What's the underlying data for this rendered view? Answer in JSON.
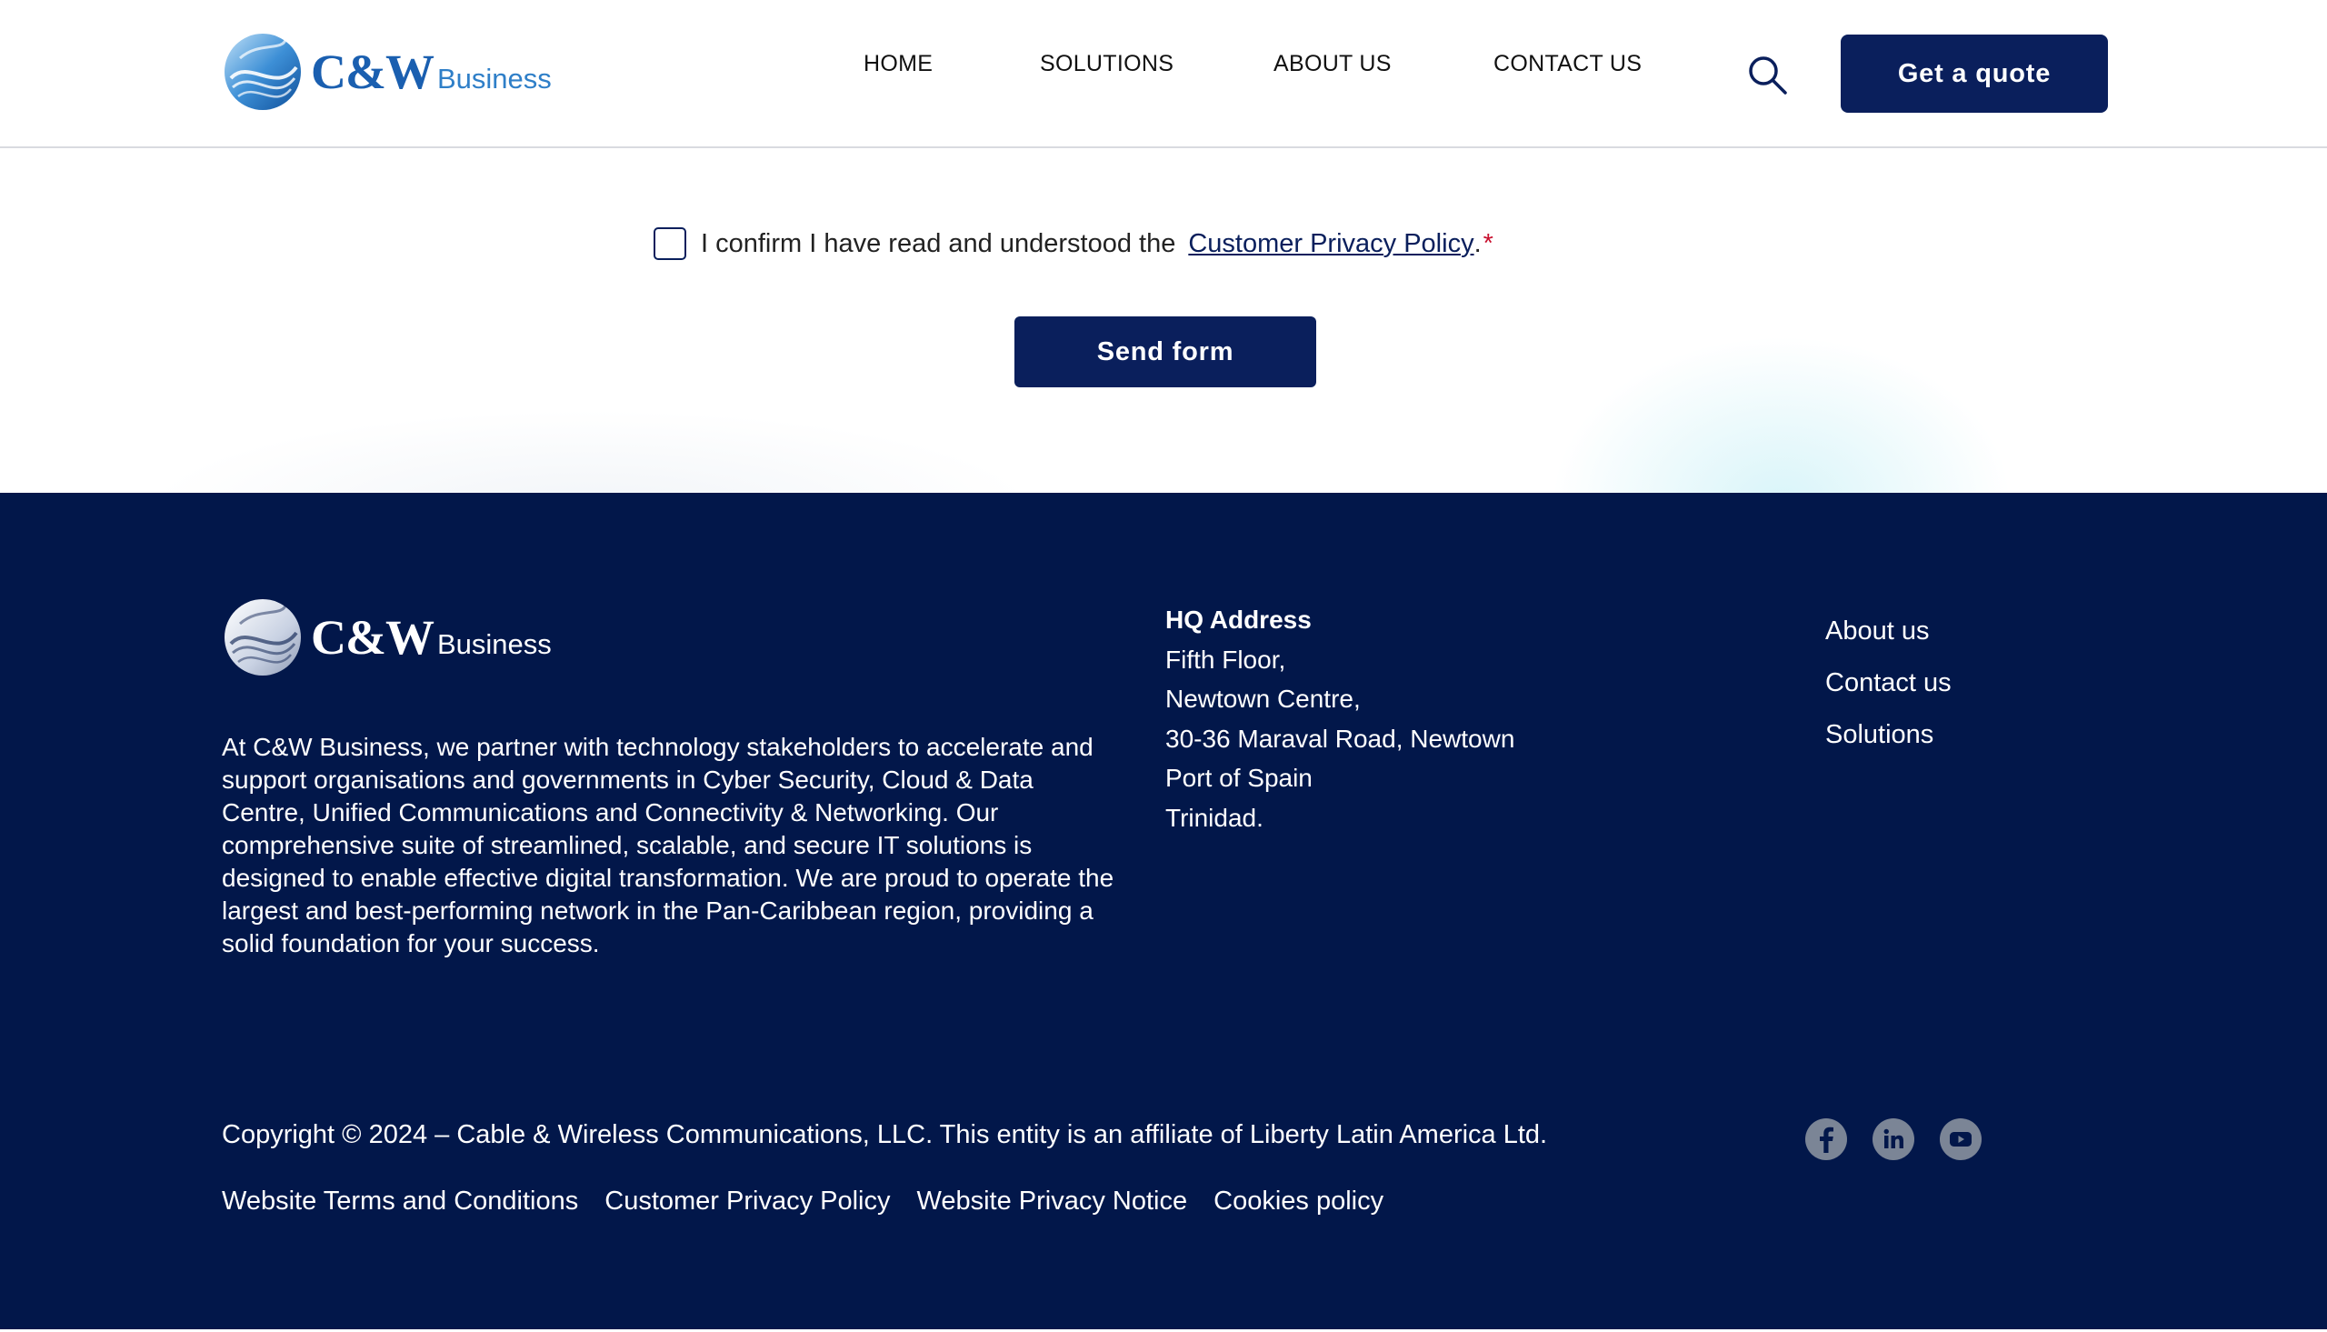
{
  "header": {
    "logo": {
      "brand": "C&W",
      "suffix": "Business"
    },
    "nav": [
      {
        "label": "HOME"
      },
      {
        "label": "SOLUTIONS"
      },
      {
        "label": "ABOUT US"
      },
      {
        "label": "CONTACT US"
      }
    ],
    "search_icon": "search-icon",
    "quote_button": "Get a quote"
  },
  "form": {
    "confirm_text": "I confirm I have read and understood the",
    "policy_link": "Customer Privacy Policy",
    "period": ".",
    "required_marker": "*",
    "checkbox_checked": false,
    "submit_label": "Send form"
  },
  "footer": {
    "logo": {
      "brand": "C&W",
      "suffix": "Business"
    },
    "about": "At C&W Business, we partner with technology stakeholders to accelerate and support organisations and governments in Cyber Security, Cloud & Data Centre, Unified Communications and Connectivity & Networking. Our comprehensive suite of streamlined, scalable, and secure IT solutions is designed to enable effective digital transformation. We are proud to operate the largest and best-performing network in the Pan-Caribbean region, providing a solid foundation for your success.",
    "hq": {
      "title": "HQ Address",
      "lines": [
        "Fifth Floor,",
        "Newtown Centre,",
        "30-36 Maraval Road, Newtown",
        "Port of Spain",
        "Trinidad."
      ]
    },
    "links": [
      "About us",
      "Contact us",
      "Solutions"
    ],
    "copyright": "Copyright © 2024 – Cable & Wireless Communications, LLC. This entity is an affiliate of Liberty Latin America Ltd.",
    "legal_links": [
      "Website Terms and Conditions",
      "Customer Privacy Policy",
      "Website Privacy Notice",
      "Cookies policy"
    ],
    "social": [
      "facebook-icon",
      "linkedin-icon",
      "youtube-icon"
    ]
  },
  "colors": {
    "navy": "#0a1f5c",
    "footer_bg": "#02174a",
    "required": "#c8102e",
    "social_icon_bg": "#7b8596"
  }
}
